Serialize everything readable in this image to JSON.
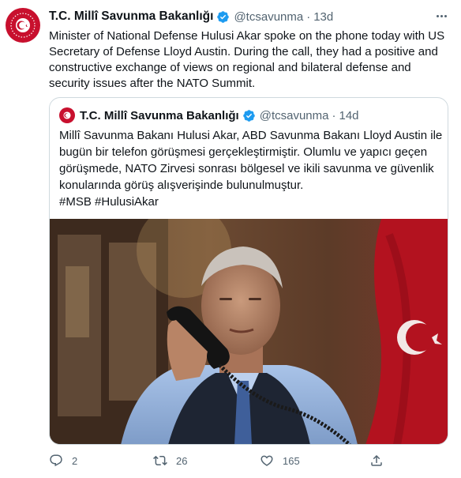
{
  "tweet": {
    "author_name": "T.C. Millî Savunma Bakanlığı",
    "handle": "@tcsavunma",
    "separator": "·",
    "time": "13d",
    "text": "Minister of National Defense Hulusi Akar spoke on the phone today with US Secretary of Defense Lloyd Austin. During the call, they had a positive and constructive exchange of views on regional and bilateral defense and security issues after the NATO Summit."
  },
  "quote": {
    "author_name": "T.C. Millî Savunma Bakanlığı",
    "handle": "@tcsavunma",
    "separator": "·",
    "time": "14d",
    "text": "Millî Savunma Bakanı Hulusi Akar, ABD Savunma Bakanı Lloyd Austin ile bugün bir telefon görüşmesi gerçekleştirmiştir. Olumlu ve yapıcı geçen görüşmede, NATO Zirvesi sonrası bölgesel ve ikili savunma ve güvenlik konularında görüş alışverişinde bulunulmuştur.",
    "hashtags": "#MSB #HulusiAkar"
  },
  "actions": {
    "replies": "2",
    "retweets": "26",
    "likes": "165"
  },
  "icons": {
    "verified": "verified-badge-icon",
    "more": "more-options-icon",
    "reply": "reply-icon",
    "retweet": "retweet-icon",
    "like": "heart-icon",
    "share": "share-icon"
  },
  "colors": {
    "accent": "#1d9bf0",
    "secondary_text": "#536471",
    "border": "#cfd9de",
    "avatar_red": "#c8102e"
  }
}
